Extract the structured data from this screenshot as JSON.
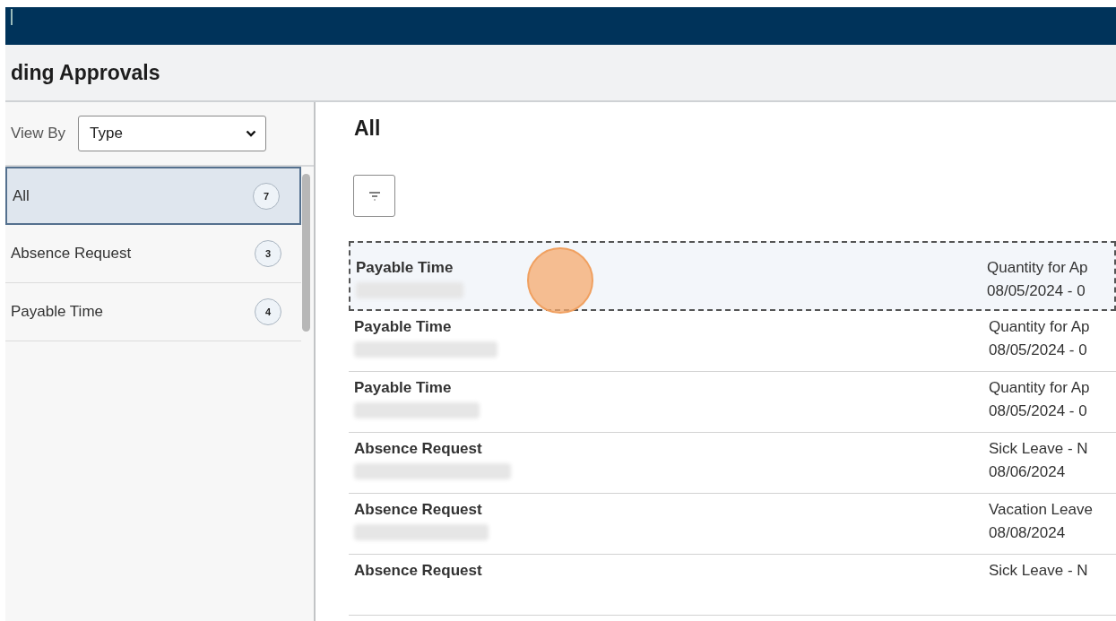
{
  "page": {
    "title": "ding Approvals"
  },
  "view_by": {
    "label": "View By",
    "value": "Type"
  },
  "categories": [
    {
      "label": "All",
      "count": "7",
      "selected": true
    },
    {
      "label": "Absence Request",
      "count": "3",
      "selected": false
    },
    {
      "label": "Payable Time",
      "count": "4",
      "selected": false
    }
  ],
  "content": {
    "heading": "All"
  },
  "approvals": [
    {
      "type": "Payable Time",
      "detail": "Quantity for Ap",
      "date": "08/05/2024 - 0",
      "selected": true
    },
    {
      "type": "Payable Time",
      "detail": "Quantity for Ap",
      "date": "08/05/2024 - 0",
      "selected": false
    },
    {
      "type": "Payable Time",
      "detail": "Quantity for Ap",
      "date": "08/05/2024 - 0",
      "selected": false
    },
    {
      "type": "Absence Request",
      "detail": "Sick Leave - N",
      "date": "08/06/2024",
      "selected": false
    },
    {
      "type": "Absence Request",
      "detail": "Vacation Leave",
      "date": "08/08/2024",
      "selected": false
    },
    {
      "type": "Absence Request",
      "detail": "Sick Leave - N",
      "selected": false
    }
  ]
}
